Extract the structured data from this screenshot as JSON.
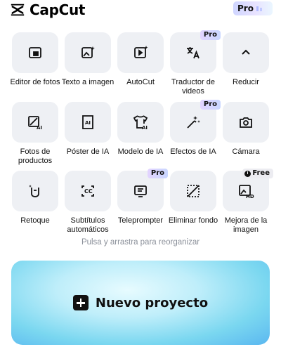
{
  "header": {
    "app_name": "CapCut",
    "logo_icon": "capcut-logo-icon",
    "pro_chip_label": "Pro"
  },
  "tools": [
    {
      "label": "Editor de fotos",
      "icon": "photo-editor-icon",
      "badge": ""
    },
    {
      "label": "Texto a imagen",
      "icon": "text-to-image-icon",
      "badge": ""
    },
    {
      "label": "AutoCut",
      "icon": "autocut-icon",
      "badge": ""
    },
    {
      "label": "Traductor de videos",
      "icon": "translate-icon",
      "badge": "Pro"
    },
    {
      "label": "Reducir",
      "icon": "chevron-up-icon",
      "badge": ""
    },
    {
      "label": "Fotos de productos",
      "icon": "product-photo-ai-icon",
      "badge": ""
    },
    {
      "label": "Póster de IA",
      "icon": "ai-poster-icon",
      "badge": ""
    },
    {
      "label": "Modelo de IA",
      "icon": "ai-model-shirt-icon",
      "badge": ""
    },
    {
      "label": "Efectos de IA",
      "icon": "magic-wand-icon",
      "badge": "Pro"
    },
    {
      "label": "Cámara",
      "icon": "camera-icon",
      "badge": ""
    },
    {
      "label": "Retoque",
      "icon": "retouch-icon",
      "badge": ""
    },
    {
      "label": "Subtítulos automáticos",
      "icon": "captions-icon",
      "badge": ""
    },
    {
      "label": "Teleprompter",
      "icon": "teleprompter-icon",
      "badge": "Pro"
    },
    {
      "label": "Eliminar fondo",
      "icon": "remove-background-icon",
      "badge": ""
    },
    {
      "label": "Mejora de la imagen",
      "icon": "image-enhance-hd-icon",
      "badge": "Free"
    }
  ],
  "hint": "Pulsa y arrastra para reorganizar",
  "cta": {
    "label": "Nuevo proyecto",
    "icon": "plus-icon"
  },
  "colors": {
    "tile_bg": "#eef0f4",
    "hint_text": "#8a8f99",
    "pro_badge": "#d8d0ff"
  }
}
